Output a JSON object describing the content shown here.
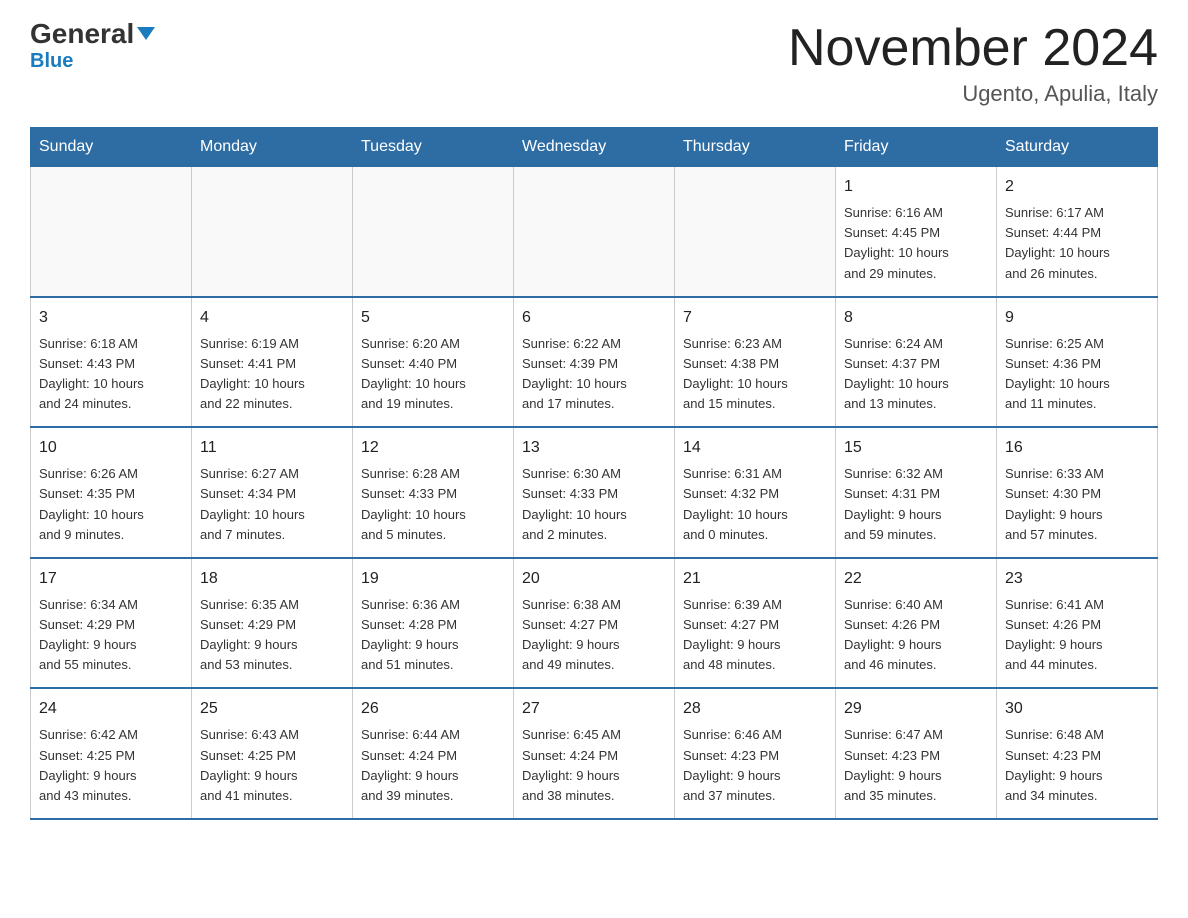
{
  "header": {
    "logo_general": "General",
    "logo_blue": "Blue",
    "main_title": "November 2024",
    "subtitle": "Ugento, Apulia, Italy"
  },
  "weekdays": [
    "Sunday",
    "Monday",
    "Tuesday",
    "Wednesday",
    "Thursday",
    "Friday",
    "Saturday"
  ],
  "weeks": [
    [
      {
        "day": "",
        "info": ""
      },
      {
        "day": "",
        "info": ""
      },
      {
        "day": "",
        "info": ""
      },
      {
        "day": "",
        "info": ""
      },
      {
        "day": "",
        "info": ""
      },
      {
        "day": "1",
        "info": "Sunrise: 6:16 AM\nSunset: 4:45 PM\nDaylight: 10 hours\nand 29 minutes."
      },
      {
        "day": "2",
        "info": "Sunrise: 6:17 AM\nSunset: 4:44 PM\nDaylight: 10 hours\nand 26 minutes."
      }
    ],
    [
      {
        "day": "3",
        "info": "Sunrise: 6:18 AM\nSunset: 4:43 PM\nDaylight: 10 hours\nand 24 minutes."
      },
      {
        "day": "4",
        "info": "Sunrise: 6:19 AM\nSunset: 4:41 PM\nDaylight: 10 hours\nand 22 minutes."
      },
      {
        "day": "5",
        "info": "Sunrise: 6:20 AM\nSunset: 4:40 PM\nDaylight: 10 hours\nand 19 minutes."
      },
      {
        "day": "6",
        "info": "Sunrise: 6:22 AM\nSunset: 4:39 PM\nDaylight: 10 hours\nand 17 minutes."
      },
      {
        "day": "7",
        "info": "Sunrise: 6:23 AM\nSunset: 4:38 PM\nDaylight: 10 hours\nand 15 minutes."
      },
      {
        "day": "8",
        "info": "Sunrise: 6:24 AM\nSunset: 4:37 PM\nDaylight: 10 hours\nand 13 minutes."
      },
      {
        "day": "9",
        "info": "Sunrise: 6:25 AM\nSunset: 4:36 PM\nDaylight: 10 hours\nand 11 minutes."
      }
    ],
    [
      {
        "day": "10",
        "info": "Sunrise: 6:26 AM\nSunset: 4:35 PM\nDaylight: 10 hours\nand 9 minutes."
      },
      {
        "day": "11",
        "info": "Sunrise: 6:27 AM\nSunset: 4:34 PM\nDaylight: 10 hours\nand 7 minutes."
      },
      {
        "day": "12",
        "info": "Sunrise: 6:28 AM\nSunset: 4:33 PM\nDaylight: 10 hours\nand 5 minutes."
      },
      {
        "day": "13",
        "info": "Sunrise: 6:30 AM\nSunset: 4:33 PM\nDaylight: 10 hours\nand 2 minutes."
      },
      {
        "day": "14",
        "info": "Sunrise: 6:31 AM\nSunset: 4:32 PM\nDaylight: 10 hours\nand 0 minutes."
      },
      {
        "day": "15",
        "info": "Sunrise: 6:32 AM\nSunset: 4:31 PM\nDaylight: 9 hours\nand 59 minutes."
      },
      {
        "day": "16",
        "info": "Sunrise: 6:33 AM\nSunset: 4:30 PM\nDaylight: 9 hours\nand 57 minutes."
      }
    ],
    [
      {
        "day": "17",
        "info": "Sunrise: 6:34 AM\nSunset: 4:29 PM\nDaylight: 9 hours\nand 55 minutes."
      },
      {
        "day": "18",
        "info": "Sunrise: 6:35 AM\nSunset: 4:29 PM\nDaylight: 9 hours\nand 53 minutes."
      },
      {
        "day": "19",
        "info": "Sunrise: 6:36 AM\nSunset: 4:28 PM\nDaylight: 9 hours\nand 51 minutes."
      },
      {
        "day": "20",
        "info": "Sunrise: 6:38 AM\nSunset: 4:27 PM\nDaylight: 9 hours\nand 49 minutes."
      },
      {
        "day": "21",
        "info": "Sunrise: 6:39 AM\nSunset: 4:27 PM\nDaylight: 9 hours\nand 48 minutes."
      },
      {
        "day": "22",
        "info": "Sunrise: 6:40 AM\nSunset: 4:26 PM\nDaylight: 9 hours\nand 46 minutes."
      },
      {
        "day": "23",
        "info": "Sunrise: 6:41 AM\nSunset: 4:26 PM\nDaylight: 9 hours\nand 44 minutes."
      }
    ],
    [
      {
        "day": "24",
        "info": "Sunrise: 6:42 AM\nSunset: 4:25 PM\nDaylight: 9 hours\nand 43 minutes."
      },
      {
        "day": "25",
        "info": "Sunrise: 6:43 AM\nSunset: 4:25 PM\nDaylight: 9 hours\nand 41 minutes."
      },
      {
        "day": "26",
        "info": "Sunrise: 6:44 AM\nSunset: 4:24 PM\nDaylight: 9 hours\nand 39 minutes."
      },
      {
        "day": "27",
        "info": "Sunrise: 6:45 AM\nSunset: 4:24 PM\nDaylight: 9 hours\nand 38 minutes."
      },
      {
        "day": "28",
        "info": "Sunrise: 6:46 AM\nSunset: 4:23 PM\nDaylight: 9 hours\nand 37 minutes."
      },
      {
        "day": "29",
        "info": "Sunrise: 6:47 AM\nSunset: 4:23 PM\nDaylight: 9 hours\nand 35 minutes."
      },
      {
        "day": "30",
        "info": "Sunrise: 6:48 AM\nSunset: 4:23 PM\nDaylight: 9 hours\nand 34 minutes."
      }
    ]
  ]
}
